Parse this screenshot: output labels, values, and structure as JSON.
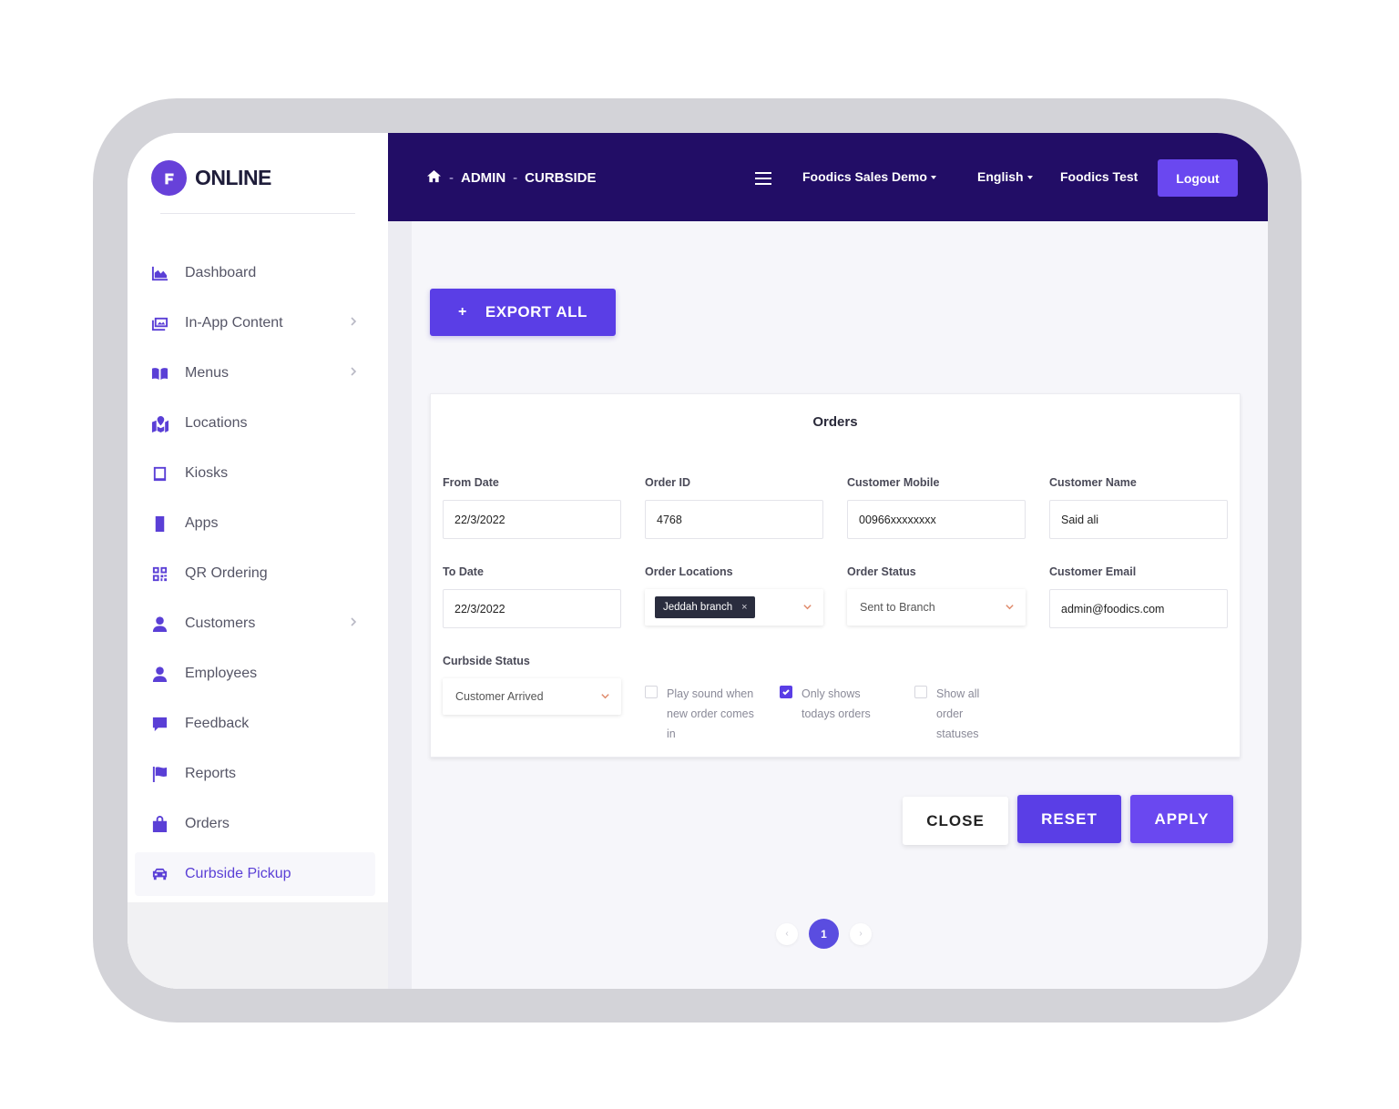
{
  "brand": {
    "name": "ONLINE"
  },
  "sidebar": {
    "items": [
      {
        "label": "Dashboard",
        "icon": "chart-area-icon"
      },
      {
        "label": "In-App Content",
        "icon": "images-icon"
      },
      {
        "label": "Menus",
        "icon": "book-open-icon"
      },
      {
        "label": "Locations",
        "icon": "map-marked-icon"
      },
      {
        "label": "Kiosks",
        "icon": "tablet-icon"
      },
      {
        "label": "Apps",
        "icon": "mobile-icon"
      },
      {
        "label": "QR Ordering",
        "icon": "qrcode-icon"
      },
      {
        "label": "Customers",
        "icon": "user-icon"
      },
      {
        "label": "Employees",
        "icon": "user-icon"
      },
      {
        "label": "Feedback",
        "icon": "comment-icon"
      },
      {
        "label": "Reports",
        "icon": "flag-icon"
      },
      {
        "label": "Orders",
        "icon": "shopping-bag-icon"
      },
      {
        "label": "Curbside Pickup",
        "icon": "car-icon"
      }
    ],
    "active": "Curbside Pickup"
  },
  "header": {
    "crumb1": "ADMIN",
    "crumb_sep": "-",
    "crumb2": "CURBSIDE",
    "business": "Foodics Sales Demo",
    "language": "English",
    "user": "Foodics Test",
    "logout": "Logout"
  },
  "toolbar": {
    "export_label": "EXPORT ALL",
    "export_plus": "+"
  },
  "filters": {
    "title": "Orders",
    "from_date": {
      "label": "From Date",
      "value": "22/3/2022"
    },
    "order_id": {
      "label": "Order ID",
      "value": "4768"
    },
    "customer_mobile": {
      "label": "Customer Mobile",
      "value": "00966xxxxxxxx"
    },
    "customer_name": {
      "label": "Customer Name",
      "value": "Said ali"
    },
    "to_date": {
      "label": "To Date",
      "value": "22/3/2022"
    },
    "order_locations": {
      "label": "Order Locations",
      "tag": "Jeddah branch",
      "tag_remove": "×"
    },
    "order_status": {
      "label": "Order Status",
      "value": "Sent to Branch"
    },
    "customer_email": {
      "label": "Customer Email",
      "value": "admin@foodics.com"
    },
    "curbside_status": {
      "label": "Curbside Status",
      "value": "Customer Arrived"
    },
    "play_sound": {
      "label": "Play sound when new order comes in",
      "checked": false
    },
    "only_today": {
      "label": "Only shows todays orders",
      "checked": true
    },
    "show_all": {
      "label": "Show all order statuses",
      "checked": false
    }
  },
  "actions": {
    "close": "CLOSE",
    "reset": "RESET",
    "apply": "APPLY"
  },
  "pagination": {
    "prev": "‹",
    "current": "1",
    "next": "›"
  },
  "colors": {
    "accent": "#5a3ee6",
    "header_bg": "#220d66"
  }
}
